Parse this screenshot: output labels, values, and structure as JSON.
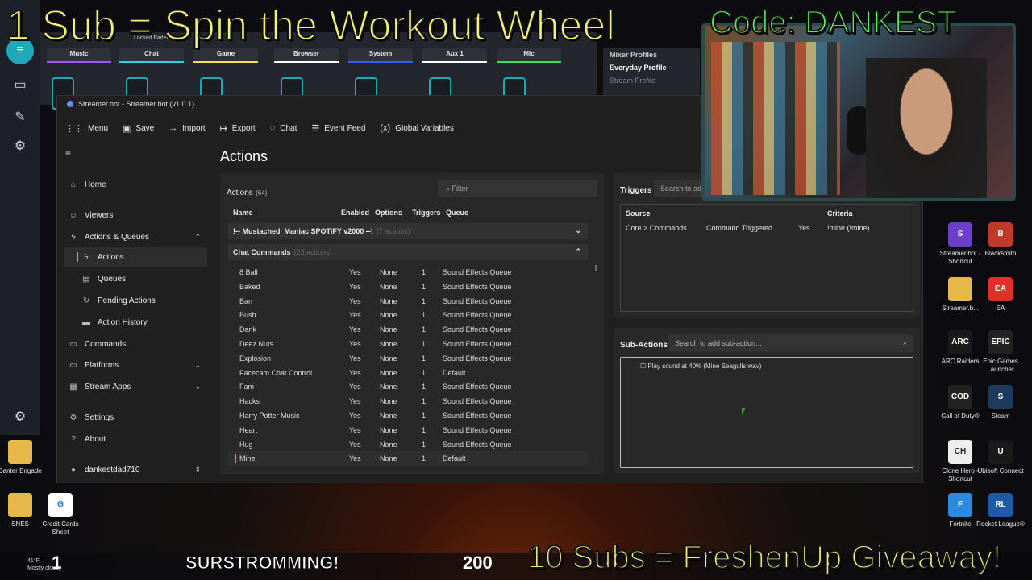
{
  "overlay": {
    "top_text": "1 Sub = Spin the Workout Wheel",
    "code_text": "Code: DANKEST",
    "bottom_text": "10 Subs = FreshenUp Giveaway!",
    "ticker_text": "SURSTROMMING!",
    "left_count": "1",
    "mid_count": "200"
  },
  "mixer": {
    "locked_label": "Locked Fader",
    "channels": [
      {
        "name": "Music",
        "color": "#9b59ff"
      },
      {
        "name": "Chat",
        "color": "#2ad4e0"
      },
      {
        "name": "Game",
        "color": "#f2e14a"
      },
      {
        "name": "Browser",
        "color": "#ffffff"
      },
      {
        "name": "System",
        "color": "#3b5bff"
      },
      {
        "name": "Aux 1",
        "color": "#ffffff"
      },
      {
        "name": "Mic",
        "color": "#3ee05a"
      }
    ],
    "profiles_title": "Mixer Profiles",
    "profiles": [
      "Everyday Profile",
      "Stream Profile"
    ]
  },
  "window": {
    "title": "Streamer.bot - Streamer.bot (v1.0.1)",
    "toolbar": {
      "menu": "Menu",
      "save": "Save",
      "import": "Import",
      "export": "Export",
      "chat": "Chat",
      "event_feed": "Event Feed",
      "global_variables": "Global Variables"
    },
    "sidebar": {
      "home": "Home",
      "viewers": "Viewers",
      "actions_queues": "Actions & Queues",
      "actions": "Actions",
      "queues": "Queues",
      "pending_actions": "Pending Actions",
      "action_history": "Action History",
      "commands": "Commands",
      "platforms": "Platforms",
      "stream_apps": "Stream Apps",
      "settings": "Settings",
      "about": "About",
      "user": "dankestdad710"
    },
    "main_title": "Actions",
    "actions_panel": {
      "label": "Actions",
      "count": "(64)",
      "filter_placeholder": "Filter",
      "columns": {
        "name": "Name",
        "enabled": "Enabled",
        "options": "Options",
        "triggers": "Triggers",
        "queue": "Queue"
      },
      "group1": {
        "name": "!-- Mustached_Maniac SPOTiFY v2000 --!",
        "count": "(7 actions)"
      },
      "group2": {
        "name": "Chat Commands",
        "count": "(23 actions)"
      },
      "rows": [
        {
          "name": "8 Ball",
          "enabled": "Yes",
          "options": "None",
          "triggers": "1",
          "queue": "Sound Effects Queue"
        },
        {
          "name": "Baked",
          "enabled": "Yes",
          "options": "None",
          "triggers": "1",
          "queue": "Sound Effects Queue"
        },
        {
          "name": "Ban",
          "enabled": "Yes",
          "options": "None",
          "triggers": "1",
          "queue": "Sound Effects Queue"
        },
        {
          "name": "Bush",
          "enabled": "Yes",
          "options": "None",
          "triggers": "1",
          "queue": "Sound Effects Queue"
        },
        {
          "name": "Dank",
          "enabled": "Yes",
          "options": "None",
          "triggers": "1",
          "queue": "Sound Effects Queue"
        },
        {
          "name": "Deez Nuts",
          "enabled": "Yes",
          "options": "None",
          "triggers": "1",
          "queue": "Sound Effects Queue"
        },
        {
          "name": "Explosion",
          "enabled": "Yes",
          "options": "None",
          "triggers": "1",
          "queue": "Sound Effects Queue"
        },
        {
          "name": "Facecam Chat Control",
          "enabled": "Yes",
          "options": "None",
          "triggers": "1",
          "queue": "Default"
        },
        {
          "name": "Fam",
          "enabled": "Yes",
          "options": "None",
          "triggers": "1",
          "queue": "Sound Effects Queue"
        },
        {
          "name": "Hacks",
          "enabled": "Yes",
          "options": "None",
          "triggers": "1",
          "queue": "Sound Effects Queue"
        },
        {
          "name": "Harry Potter Music",
          "enabled": "Yes",
          "options": "None",
          "triggers": "1",
          "queue": "Sound Effects Queue"
        },
        {
          "name": "Heart",
          "enabled": "Yes",
          "options": "None",
          "triggers": "1",
          "queue": "Sound Effects Queue"
        },
        {
          "name": "Hug",
          "enabled": "Yes",
          "options": "None",
          "triggers": "1",
          "queue": "Sound Effects Queue"
        },
        {
          "name": "Mine",
          "enabled": "Yes",
          "options": "None",
          "triggers": "1",
          "queue": "Default"
        }
      ]
    },
    "triggers_panel": {
      "label": "Triggers",
      "search_placeholder": "Search to ad",
      "columns": {
        "source": "Source",
        "criteria": "Criteria"
      },
      "row": {
        "source": "Core > Commands",
        "type": "Command Triggered",
        "enabled": "Yes",
        "criteria": "!mine (!mine)"
      }
    },
    "subactions_panel": {
      "label": "Sub-Actions",
      "search_placeholder": "Search to add sub-action...",
      "item": "Play sound at 40% (Mine Seagulls.wav)"
    }
  },
  "desktop_icons_right": [
    {
      "label": "Streamer.bot - Shortcut",
      "color": "#6b3fc9",
      "glyph": "S"
    },
    {
      "label": "Blacksmith",
      "color": "#c0392b",
      "glyph": "B"
    },
    {
      "label": "Streamer.b...",
      "color": "#e6b84a",
      "glyph": ""
    },
    {
      "label": "EA",
      "color": "#e0302a",
      "glyph": "EA"
    },
    {
      "label": "ARC Raiders",
      "color": "#1a1a1a",
      "glyph": "ARC"
    },
    {
      "label": "Epic Games Launcher",
      "color": "#222",
      "glyph": "EPIC"
    },
    {
      "label": "Call of Duty®",
      "color": "#222",
      "glyph": "COD"
    },
    {
      "label": "Steam",
      "color": "#1b3a5c",
      "glyph": "S"
    },
    {
      "label": "Clone Hero - Shortcut",
      "color": "#eee",
      "glyph": "CH"
    },
    {
      "label": "Ubisoft Connect",
      "color": "#1a1a1a",
      "glyph": "U"
    },
    {
      "label": "Fortnite",
      "color": "#2a8ae0",
      "glyph": "F"
    },
    {
      "label": "Rocket League®",
      "color": "#1e5aa8",
      "glyph": "RL"
    }
  ],
  "desktop_icons_left": [
    {
      "label": "Banter Brigade",
      "color": "#e6b84a",
      "glyph": ""
    },
    {
      "label": "SNES",
      "color": "#e6b84a",
      "glyph": ""
    },
    {
      "label": "Credit Cards Sheet",
      "color": "#ffffff",
      "glyph": "G"
    }
  ],
  "weather": {
    "temp": "41°F",
    "desc": "Mostly cloudy"
  }
}
